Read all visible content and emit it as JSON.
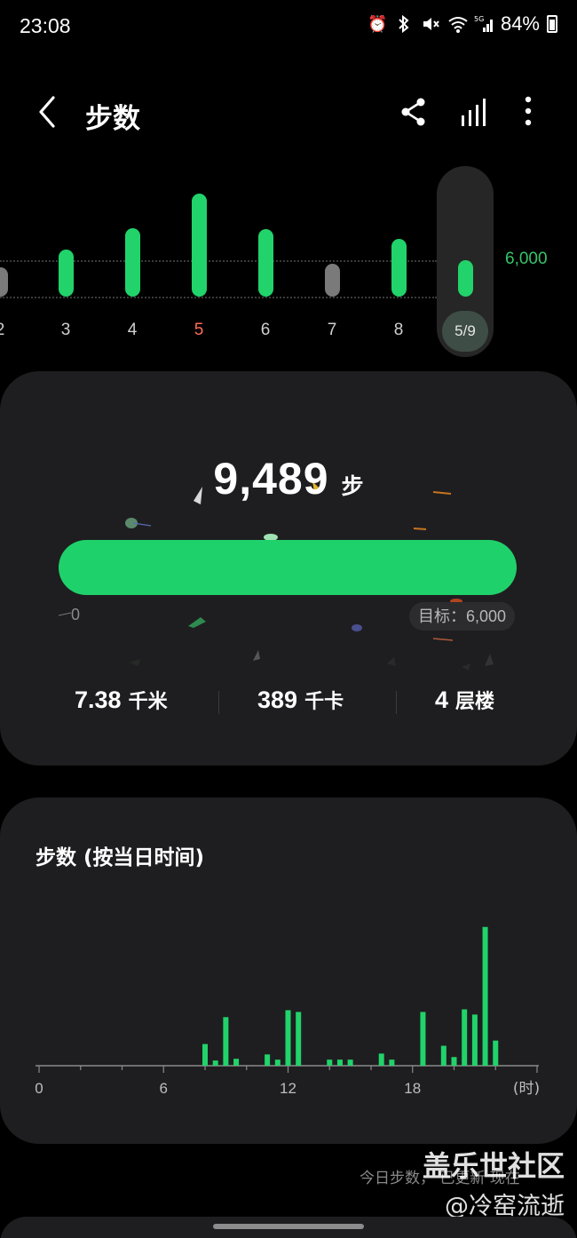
{
  "status_bar": {
    "time": "23:08",
    "battery": "84%",
    "icons": [
      "alarm-icon",
      "bluetooth-icon",
      "mute-icon",
      "wifi-icon",
      "5g-signal-icon",
      "battery-icon"
    ]
  },
  "header": {
    "title": "步数",
    "actions": [
      "share-icon",
      "trends-icon",
      "more-icon"
    ]
  },
  "weekly": {
    "goal_label": "6,000",
    "days": [
      {
        "label": "2",
        "steps": 4200,
        "met_goal": false
      },
      {
        "label": "3",
        "steps": 6800,
        "met_goal": true
      },
      {
        "label": "4",
        "steps": 9900,
        "met_goal": true
      },
      {
        "label": "5",
        "steps": 14900,
        "met_goal": true,
        "highlight": true
      },
      {
        "label": "6",
        "steps": 9700,
        "met_goal": true
      },
      {
        "label": "7",
        "steps": 4700,
        "met_goal": false
      },
      {
        "label": "8",
        "steps": 8400,
        "met_goal": true
      }
    ],
    "selected": {
      "label": "5/9",
      "steps": 9489
    }
  },
  "today": {
    "steps": "9,489",
    "steps_unit": "步",
    "progress_min": "0",
    "goal_chip": "目标：6,000",
    "stats": [
      {
        "value": "7.38",
        "unit": "千米"
      },
      {
        "value": "389",
        "unit": "千卡"
      },
      {
        "value": "4",
        "unit": "层楼"
      }
    ]
  },
  "chart_data": {
    "type": "bar",
    "title": "步数 (按当日时间)",
    "x_ticks": [
      "0",
      "6",
      "12",
      "18"
    ],
    "x_unit": "(时)",
    "xlim": [
      0,
      24
    ],
    "x": [
      8.0,
      8.5,
      9.0,
      9.5,
      11.0,
      11.5,
      12.0,
      12.5,
      14.0,
      14.5,
      15.0,
      16.5,
      17.0,
      18.5,
      19.5,
      20.0,
      20.5,
      21.0,
      21.5,
      22.0
    ],
    "values": [
      250,
      60,
      560,
      80,
      130,
      70,
      640,
      620,
      70,
      70,
      70,
      140,
      70,
      620,
      230,
      100,
      650,
      590,
      1600,
      290
    ],
    "ylim": [
      0,
      1700
    ],
    "color": "#21d36a"
  },
  "footer": {
    "note": "今日步数，  已更新 现在",
    "watermark_line1": "盖乐世社区",
    "watermark_line2": "@冷窑流逝"
  },
  "colors": {
    "accent": "#21d36a",
    "goal_text": "#34c56a",
    "highlight_day": "#ff6b5b",
    "card_bg": "#1e1e20"
  }
}
